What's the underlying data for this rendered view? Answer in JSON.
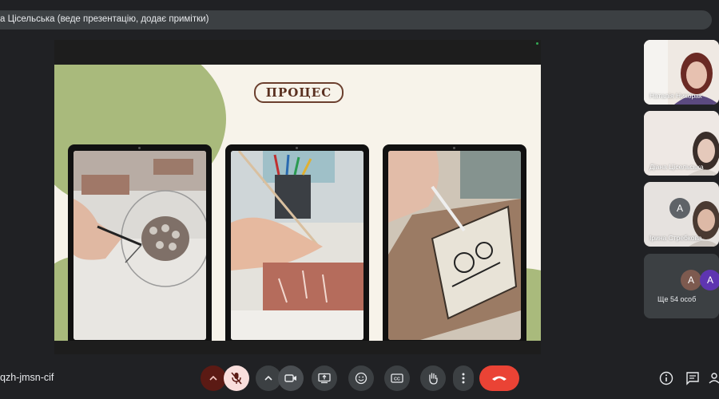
{
  "presenter_banner": "а Цісельська (веде презентацію, додає примітки)",
  "slide": {
    "title": "ПРОЦЕС"
  },
  "participants": [
    {
      "name": "Наталія Никорак"
    },
    {
      "name": "Діана Цісельська"
    },
    {
      "name": "Ірина Стребкова",
      "avatar_letter": "А"
    }
  ],
  "others": {
    "avatars": [
      "А",
      "А"
    ],
    "label": "Ще 54 особ"
  },
  "meeting_code": "qzh-jmsn-cif",
  "icons": [
    "chevron-up-icon",
    "mic-off-icon",
    "camera-icon",
    "present-icon",
    "emoji-icon",
    "captions-icon",
    "raise-hand-icon",
    "more-icon",
    "hang-up-icon",
    "info-icon",
    "chat-icon",
    "people-icon"
  ],
  "colors": {
    "accent_green": "#a9ba7c",
    "hangup_red": "#ea4335",
    "mic_off_bg": "#f9dedc",
    "tile_dark": "#3c4043"
  }
}
